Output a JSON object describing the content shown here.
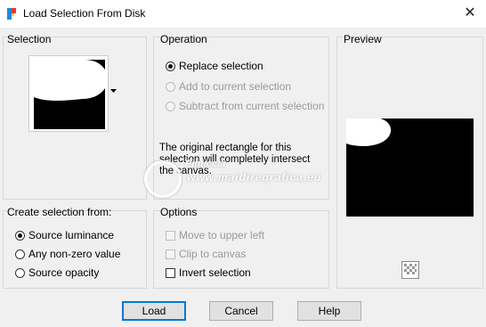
{
  "window": {
    "title": "Load Selection From Disk",
    "close_symbol": "✕"
  },
  "selection": {
    "label": "Selection"
  },
  "operation": {
    "label": "Operation",
    "options": [
      {
        "label": "Replace selection",
        "checked": true,
        "enabled": true
      },
      {
        "label": "Add to current selection",
        "checked": false,
        "enabled": false
      },
      {
        "label": "Subtract from current selection",
        "checked": false,
        "enabled": false
      }
    ],
    "note_lines": [
      "The original rectangle for this",
      "selection will completely intersect",
      "the canvas."
    ]
  },
  "preview": {
    "label": "Preview"
  },
  "create_from": {
    "label": "Create selection from:",
    "options": [
      {
        "label": "Source luminance",
        "checked": true
      },
      {
        "label": "Any non-zero value",
        "checked": false
      },
      {
        "label": "Source opacity",
        "checked": false
      }
    ]
  },
  "options": {
    "label": "Options",
    "items": [
      {
        "label": "Move to upper left",
        "checked": false,
        "enabled": false
      },
      {
        "label": "Clip to canvas",
        "checked": false,
        "enabled": false
      },
      {
        "label": "Invert selection",
        "checked": false,
        "enabled": true
      }
    ]
  },
  "watermark": {
    "line1": "Pinuccia",
    "line2": "www.maidiregrafica.eu"
  },
  "buttons": {
    "load": "Load",
    "cancel": "Cancel",
    "help": "Help"
  }
}
